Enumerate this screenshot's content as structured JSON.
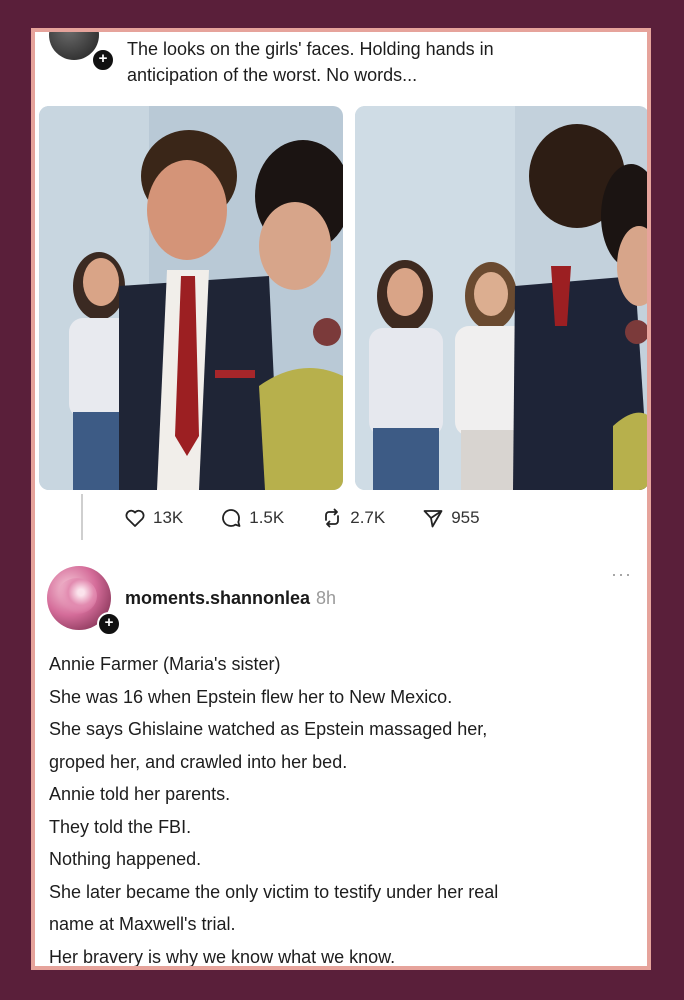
{
  "post": {
    "caption_line1": "The looks on the girls' faces. Holding hands in",
    "caption_line2": "anticipation of the worst. No words...",
    "stats": {
      "likes": "13K",
      "comments": "1.5K",
      "reposts": "2.7K",
      "shares": "955"
    }
  },
  "reply": {
    "username": "moments.shannonlea",
    "time": "8h",
    "more_label": "···",
    "lines": [
      "Annie Farmer (Maria's sister)",
      "She was 16 when Epstein flew her to New Mexico.",
      "She says Ghislaine watched as Epstein massaged her,",
      "groped her, and crawled into her bed.",
      "Annie told her parents.",
      "They told the FBI.",
      "Nothing happened.",
      "She later became the only victim to testify under her real",
      "name at Maxwell's trial.",
      "Her bravery is why we know what we know."
    ]
  },
  "colors": {
    "background": "#5a1f3a",
    "frame_border": "#e6a39b",
    "text": "#1d1d1d"
  }
}
